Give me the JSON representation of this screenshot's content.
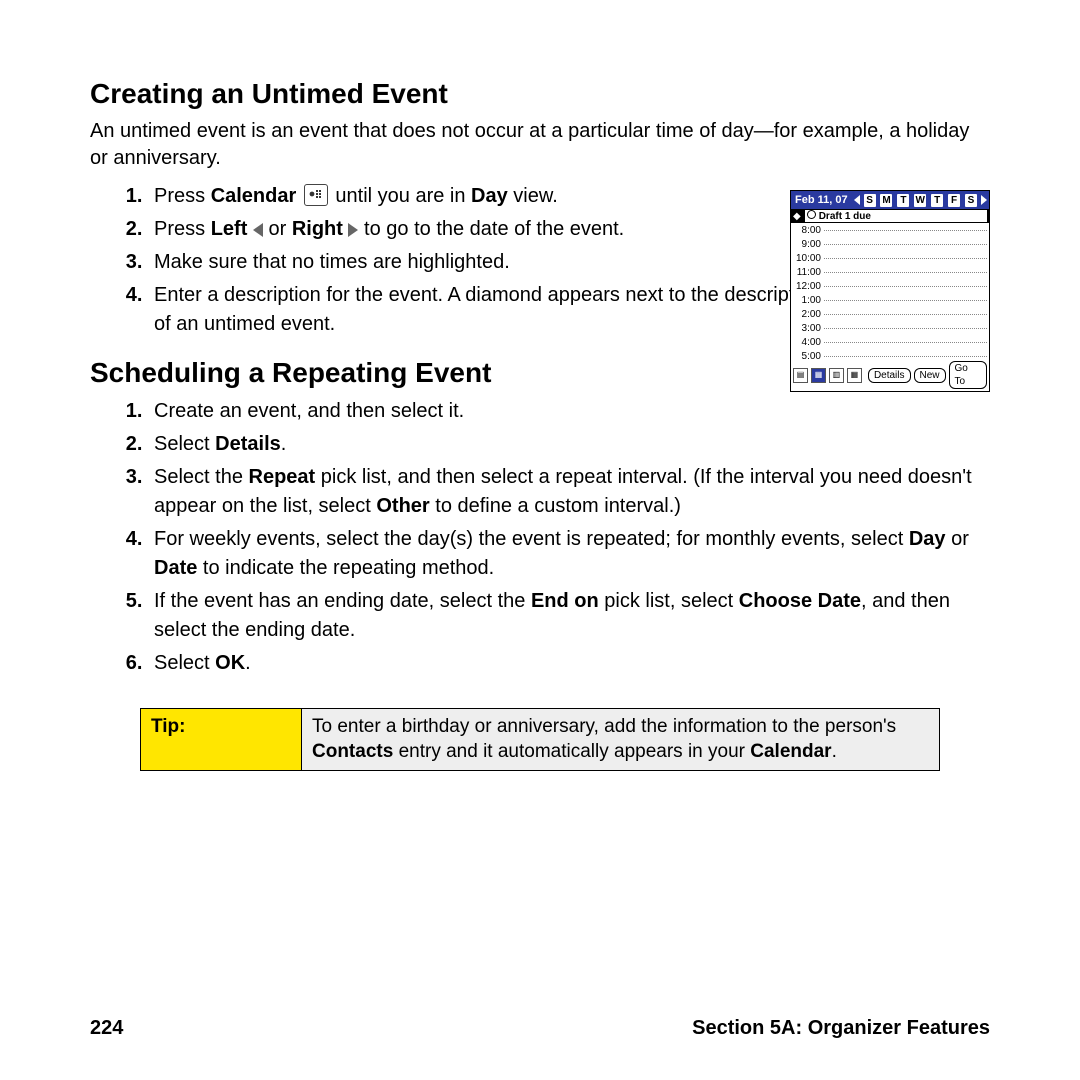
{
  "heading1": "Creating an Untimed Event",
  "intro1": "An untimed event is an event that does not occur at a particular time of day—for example, a holiday or anniversary.",
  "list1": {
    "s1a": "Press ",
    "s1b": "Calendar",
    "s1c": " until you are in ",
    "s1d": "Day",
    "s1e": " view.",
    "s2a": "Press ",
    "s2b": "Left",
    "s2c": " or ",
    "s2d": "Right",
    "s2e": " to go to the date of the event.",
    "s3": "Make sure that no times are highlighted.",
    "s4": "Enter a description for the event. A diamond appears next to the description of an untimed event."
  },
  "heading2": "Scheduling a Repeating Event",
  "list2": {
    "s1": "Create an event, and then select it.",
    "s2a": "Select ",
    "s2b": "Details",
    "s2c": ".",
    "s3a": "Select the ",
    "s3b": "Repeat",
    "s3c": " pick list, and then select a repeat interval. (If the interval you need doesn't appear on the list, select ",
    "s3d": "Other",
    "s3e": " to define a custom interval.)",
    "s4a": "For weekly events, select the day(s) the event is repeated; for monthly events, select ",
    "s4b": "Day",
    "s4c": " or ",
    "s4d": "Date",
    "s4e": " to indicate the repeating method.",
    "s5a": "If the event has an ending date, select the ",
    "s5b": "End on",
    "s5c": " pick list, select ",
    "s5d": "Choose Date",
    "s5e": ", and then select the ending date.",
    "s6a": "Select ",
    "s6b": "OK",
    "s6c": "."
  },
  "tip": {
    "label": "Tip:",
    "a": "To enter a birthday or anniversary, add the information to the person's ",
    "b": "Contacts",
    "c": " entry and it automatically appears in your ",
    "d": "Calendar",
    "e": "."
  },
  "device": {
    "date": "Feb 11, 07",
    "days": [
      "S",
      "M",
      "T",
      "W",
      "T",
      "F",
      "S"
    ],
    "event": "Draft 1 due",
    "hours": [
      "8:00",
      "9:00",
      "10:00",
      "11:00",
      "12:00",
      "1:00",
      "2:00",
      "3:00",
      "4:00",
      "5:00"
    ],
    "buttons": {
      "details": "Details",
      "new": "New",
      "goto": "Go To"
    }
  },
  "footer": {
    "page": "224",
    "section": "Section 5A: Organizer Features"
  }
}
